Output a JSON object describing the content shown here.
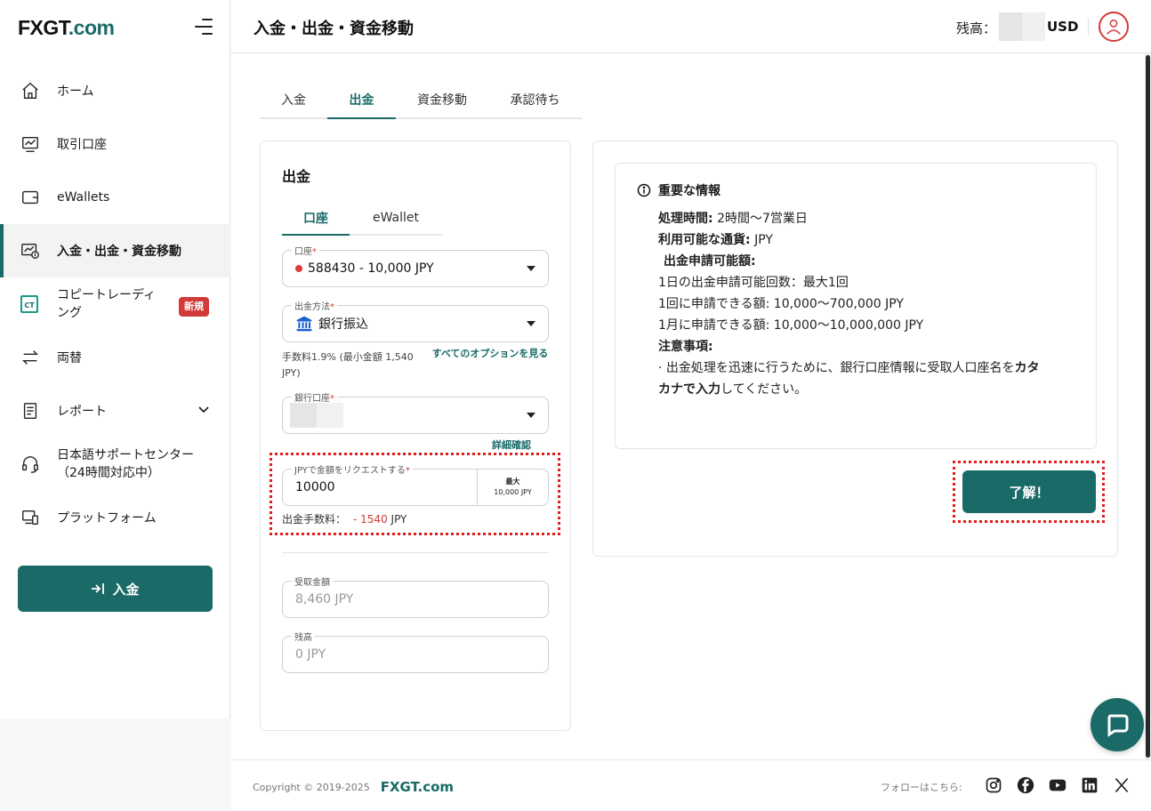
{
  "brand": {
    "logo_main": "FXGT",
    "logo_dot": ".com"
  },
  "colors": {
    "accent": "#1a6b67",
    "danger": "#d33a3a",
    "highlight": "#e31c1c"
  },
  "sidebar": {
    "items": [
      {
        "label": "ホーム",
        "icon": "home-icon"
      },
      {
        "label": "取引口座",
        "icon": "trading-account-icon"
      },
      {
        "label": "eWallets",
        "icon": "wallet-icon"
      },
      {
        "label": "入金・出金・資金移動",
        "icon": "transfer-icon",
        "active": true
      },
      {
        "label_line1": "コピートレーディ",
        "label_line2": "ング",
        "icon": "copy-trading-icon",
        "badge": "新規"
      },
      {
        "label": "両替",
        "icon": "exchange-icon"
      },
      {
        "label": "レポート",
        "icon": "report-icon"
      },
      {
        "label_line1": "日本語サポートセンター",
        "label_line2": "（24時間対応中）",
        "icon": "support-icon"
      },
      {
        "label": "プラットフォーム",
        "icon": "platform-icon"
      }
    ],
    "deposit_button": "入金"
  },
  "header": {
    "title": "入金・出金・資金移動",
    "balance_label": "残高：",
    "balance_currency": "USD"
  },
  "tabs": [
    "入金",
    "出金",
    "資金移動",
    "承認待ち"
  ],
  "withdraw": {
    "title": "出金",
    "subtabs": [
      "口座",
      "eWallet"
    ],
    "account_label": "口座",
    "account_value": "588430 - 10,000 JPY",
    "method_label": "出金方法",
    "method_value": "銀行振込",
    "fee_note": "手数料1.9% (最小金額 1,540 JPY)",
    "all_options": "すべてのオプションを見る",
    "bank_label": "銀行口座",
    "detail_link": "詳細確認",
    "amount_label": "JPYで金額をリクエストする",
    "amount_value": "10000",
    "max_label": "最大",
    "max_value": "10,000 JPY",
    "fee_label": "出金手数料：",
    "fee_amount": "- 1540",
    "fee_currency": "JPY",
    "receive_label": "受取金額",
    "receive_value": "8,460 JPY",
    "balance_label": "残高",
    "balance_value": "0 JPY"
  },
  "info": {
    "title": "重要な情報",
    "processing_label": "処理時間:",
    "processing_value": "2時間〜7営業日",
    "currency_label": "利用可能な通貨:",
    "currency_value": "JPY",
    "limits_label": "出金申請可能額:",
    "line_daily": "1日の出金申請可能回数：最大1回",
    "line_per": "1回に申請できる額: 10,000〜700,000 JPY",
    "line_month": "1月に申請できる額: 10,000〜10,000,000 JPY",
    "notes_label": "注意事項:",
    "note_part1": "· 出金処理を迅速に行うために、銀行口座情報に受取人口座名を",
    "note_bold": "カタカナで入力",
    "note_part2": "してください。"
  },
  "ok_button": "了解！",
  "footer": {
    "copyright": "Copyright © 2019-2025",
    "brand": "FXGT.com",
    "follow": "フォローはこちら:",
    "socials": [
      "instagram-icon",
      "facebook-icon",
      "youtube-icon",
      "linkedin-icon",
      "x-icon"
    ]
  }
}
